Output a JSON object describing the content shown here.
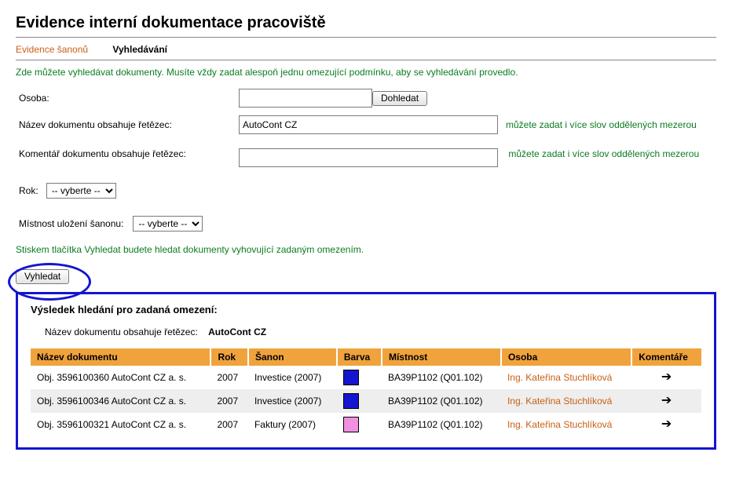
{
  "page_title": "Evidence interní dokumentace pracoviště",
  "tabs": {
    "evidence": "Evidence šanonů",
    "search": "Vyhledávání",
    "active": "search"
  },
  "intro_text": "Zde můžete vyhledávat dokumenty. Musíte vždy zadat alespoň jednu omezující podmínku, aby se vyhledávání provedlo.",
  "form": {
    "osoba": {
      "label": "Osoba:",
      "value": "",
      "button": "Dohledat"
    },
    "nazev": {
      "label": "Název dokumentu obsahuje řetězec:",
      "value": "AutoCont CZ",
      "hint": "můžete zadat i více slov oddělených mezerou"
    },
    "komentar": {
      "label": "Komentář dokumentu obsahuje řetězec:",
      "value": "",
      "hint": "můžete zadat i více slov oddělených mezerou"
    },
    "rok": {
      "label": "Rok:",
      "selected": "-- vyberte --"
    },
    "mistnost": {
      "label": "Místnost uložení šanonu:",
      "selected": "-- vyberte --"
    },
    "instruction": "Stiskem tlačítka Vyhledat budete hledat dokumenty vyhovující zadaným omezením.",
    "submit": "Vyhledat"
  },
  "results": {
    "title": "Výsledek hledání pro zadaná omezení:",
    "criteria_label": "Název dokumentu obsahuje řetězec:",
    "criteria_value": "AutoCont CZ",
    "columns": {
      "nazev": "Název dokumentu",
      "rok": "Rok",
      "sanon": "Šanon",
      "barva": "Barva",
      "mistnost": "Místnost",
      "osoba": "Osoba",
      "komentare": "Komentáře"
    },
    "rows": [
      {
        "nazev": "Obj. 3596100360 AutoCont CZ a. s.",
        "rok": "2007",
        "sanon": "Investice (2007)",
        "barva": "#1515d0",
        "mistnost": "BA39P1102 (Q01.102)",
        "osoba": "Ing. Kateřina Stuchlíková"
      },
      {
        "nazev": "Obj. 3596100346 AutoCont CZ a. s.",
        "rok": "2007",
        "sanon": "Investice (2007)",
        "barva": "#1515d0",
        "mistnost": "BA39P1102 (Q01.102)",
        "osoba": "Ing. Kateřina Stuchlíková"
      },
      {
        "nazev": "Obj. 3596100321 AutoCont CZ a. s.",
        "rok": "2007",
        "sanon": "Faktury (2007)",
        "barva": "#f090e0",
        "mistnost": "BA39P1102 (Q01.102)",
        "osoba": "Ing. Kateřina Stuchlíková"
      }
    ]
  }
}
